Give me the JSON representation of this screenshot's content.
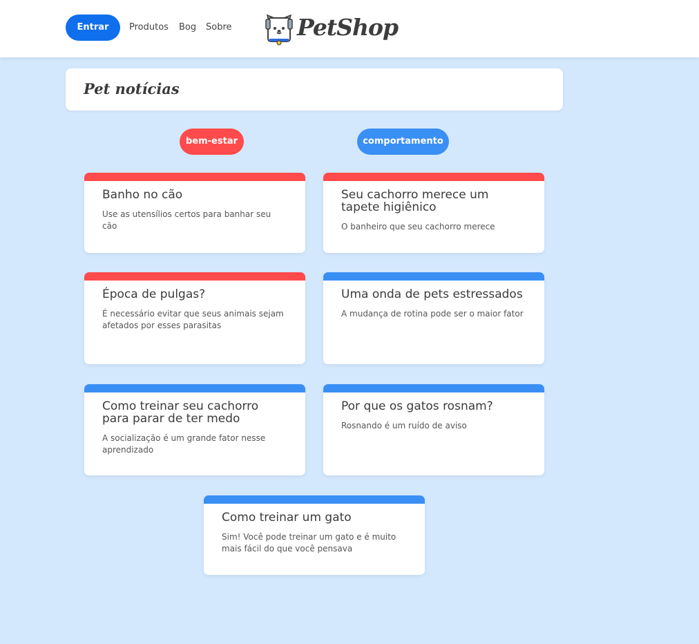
{
  "header": {
    "login_label": "Entrar",
    "nav": [
      "Produtos",
      "Bog",
      "Sobre"
    ],
    "logo_text": "PetShop"
  },
  "page": {
    "title": "Pet notícias"
  },
  "colors": {
    "bem_estar": "#ff4b4b",
    "comportamento": "#3a8ff5",
    "primary": "#0f6fec",
    "background": "#d4e8fd"
  },
  "filters": [
    {
      "label": "bem-estar",
      "category": "bem-estar"
    },
    {
      "label": "comportamento",
      "category": "comportamento"
    }
  ],
  "articles": [
    {
      "title": "Banho no cão",
      "description": "Use as utensílios certos para banhar seu cão",
      "category": "bem-estar"
    },
    {
      "title": "Seu cachorro merece um tapete higiênico",
      "description": "O banheiro que seu cachorro merece",
      "category": "bem-estar"
    },
    {
      "title": "Época de pulgas?",
      "description": "É necessário evitar que seus animais sejam afetados por esses parasitas",
      "category": "bem-estar"
    },
    {
      "title": "Uma onda de pets estressados",
      "description": "A mudança de rotina pode ser o maior fator",
      "category": "comportamento"
    },
    {
      "title": "Como treinar seu cachorro para parar de ter medo",
      "description": "A socialização é um grande fator nesse aprendizado",
      "category": "comportamento"
    },
    {
      "title": "Por que os gatos rosnam?",
      "description": "Rosnando é um ruído de aviso",
      "category": "comportamento"
    },
    {
      "title": "Como treinar um gato",
      "description": "Sim! Você pode treinar um gato e é muito mais fácil do que você pensava",
      "category": "comportamento"
    }
  ]
}
